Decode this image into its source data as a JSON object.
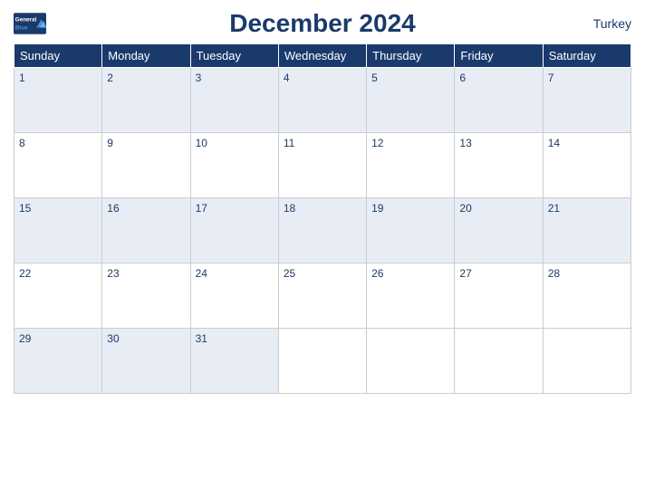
{
  "header": {
    "logo_line1": "General",
    "logo_line2": "Blue",
    "title": "December 2024",
    "country": "Turkey"
  },
  "days_of_week": [
    "Sunday",
    "Monday",
    "Tuesday",
    "Wednesday",
    "Thursday",
    "Friday",
    "Saturday"
  ],
  "weeks": [
    [
      1,
      2,
      3,
      4,
      5,
      6,
      7
    ],
    [
      8,
      9,
      10,
      11,
      12,
      13,
      14
    ],
    [
      15,
      16,
      17,
      18,
      19,
      20,
      21
    ],
    [
      22,
      23,
      24,
      25,
      26,
      27,
      28
    ],
    [
      29,
      30,
      31,
      null,
      null,
      null,
      null
    ]
  ]
}
